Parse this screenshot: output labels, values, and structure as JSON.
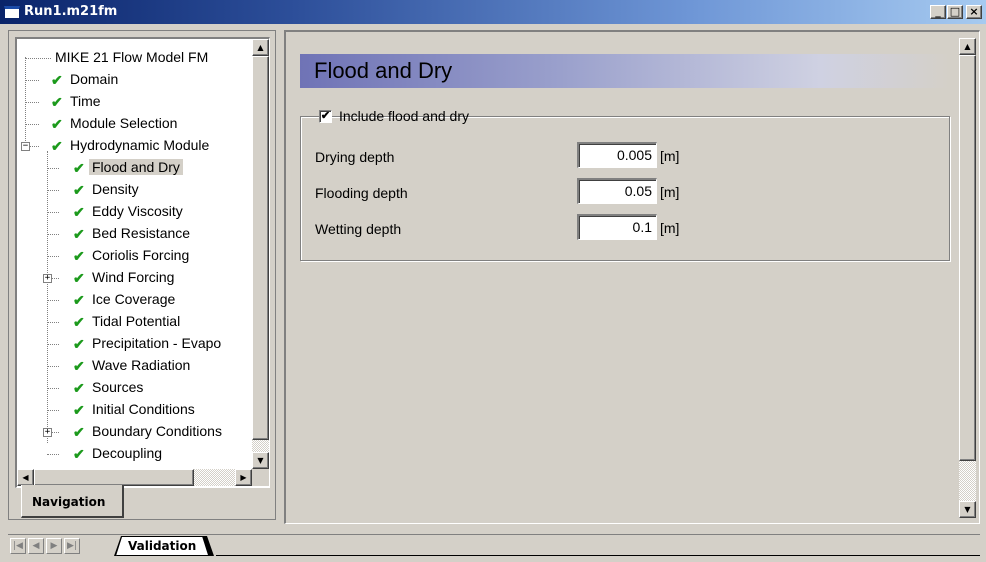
{
  "window": {
    "title": "Run1.m21fm",
    "controls": {
      "minimize": "_",
      "maximize": "□",
      "close": "×"
    }
  },
  "navigation": {
    "tab_label": "Navigation",
    "tree": [
      {
        "label": "MIKE 21 Flow Model FM",
        "level": 0,
        "checked": false,
        "expander": ""
      },
      {
        "label": "Domain",
        "level": 1,
        "checked": true,
        "expander": ""
      },
      {
        "label": "Time",
        "level": 1,
        "checked": true,
        "expander": ""
      },
      {
        "label": "Module Selection",
        "level": 1,
        "checked": true,
        "expander": ""
      },
      {
        "label": "Hydrodynamic Module",
        "level": 1,
        "checked": true,
        "expander": "minus"
      },
      {
        "label": "Flood and Dry",
        "level": 2,
        "checked": true,
        "expander": "",
        "selected": true
      },
      {
        "label": "Density",
        "level": 2,
        "checked": true,
        "expander": ""
      },
      {
        "label": "Eddy Viscosity",
        "level": 2,
        "checked": true,
        "expander": ""
      },
      {
        "label": "Bed Resistance",
        "level": 2,
        "checked": true,
        "expander": ""
      },
      {
        "label": "Coriolis Forcing",
        "level": 2,
        "checked": true,
        "expander": ""
      },
      {
        "label": "Wind Forcing",
        "level": 2,
        "checked": true,
        "expander": "plus"
      },
      {
        "label": "Ice Coverage",
        "level": 2,
        "checked": true,
        "expander": ""
      },
      {
        "label": "Tidal Potential",
        "level": 2,
        "checked": true,
        "expander": ""
      },
      {
        "label": "Precipitation - Evapo",
        "level": 2,
        "checked": true,
        "expander": ""
      },
      {
        "label": "Wave Radiation",
        "level": 2,
        "checked": true,
        "expander": ""
      },
      {
        "label": "Sources",
        "level": 2,
        "checked": true,
        "expander": ""
      },
      {
        "label": "Initial Conditions",
        "level": 2,
        "checked": true,
        "expander": ""
      },
      {
        "label": "Boundary Conditions",
        "level": 2,
        "checked": true,
        "expander": "plus"
      },
      {
        "label": "Decoupling",
        "level": 2,
        "checked": true,
        "expander": ""
      }
    ]
  },
  "main": {
    "section_title": "Flood and Dry",
    "include_checkbox": {
      "label": "Include flood and dry",
      "checked": true,
      "mark": "✔"
    },
    "fields": [
      {
        "label": "Drying depth",
        "value": "0.005",
        "unit": "[m]"
      },
      {
        "label": "Flooding depth",
        "value": "0.05",
        "unit": "[m]"
      },
      {
        "label": "Wetting depth",
        "value": "0.1",
        "unit": "[m]"
      }
    ]
  },
  "bottom": {
    "nav_buttons": [
      "|◀",
      "◀",
      "▶",
      "▶|"
    ],
    "tab_label": "Validation"
  },
  "icons": {
    "check": "check-icon",
    "tree_plus": "⊞",
    "tree_minus": "⊟"
  },
  "colors": {
    "check_green": "#1c9a1c",
    "header_gradient_start": "#6f73b6",
    "titlebar_start": "#0a246a"
  }
}
